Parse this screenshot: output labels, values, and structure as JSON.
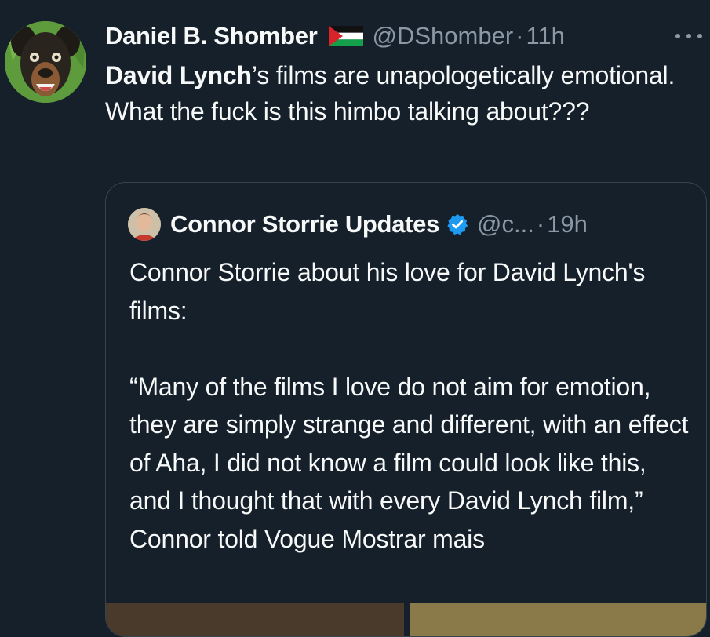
{
  "tweet": {
    "author_name": "Daniel B. Shomber",
    "handle": "@DShomber",
    "separator": "·",
    "time": "11h",
    "mention": "David Lynch",
    "text_rest": "’s films are unapologetically emotional. What the fuck is this himbo talking about???"
  },
  "quote": {
    "author_name": "Connor Storrie Updates",
    "handle": "@c...",
    "separator": "·",
    "time": "19h",
    "text": "Connor Storrie about his love for David Lynch's films:\n\n“Many of the films I love do not aim for emotion, they are simply strange and different, with an effect of Aha, I did not know a film could look like this, and I thought that with every David Lynch film,” Connor told Vogue Mostrar mais"
  },
  "icons": {
    "flag": "palestine-flag-icon",
    "more": "more-options-icon",
    "verified": "verified-badge-icon"
  },
  "colors": {
    "background": "#15202b",
    "text_primary": "#f7f9f9",
    "text_secondary": "#8b98a5",
    "border": "#38444d",
    "verified": "#1d9bf0"
  }
}
